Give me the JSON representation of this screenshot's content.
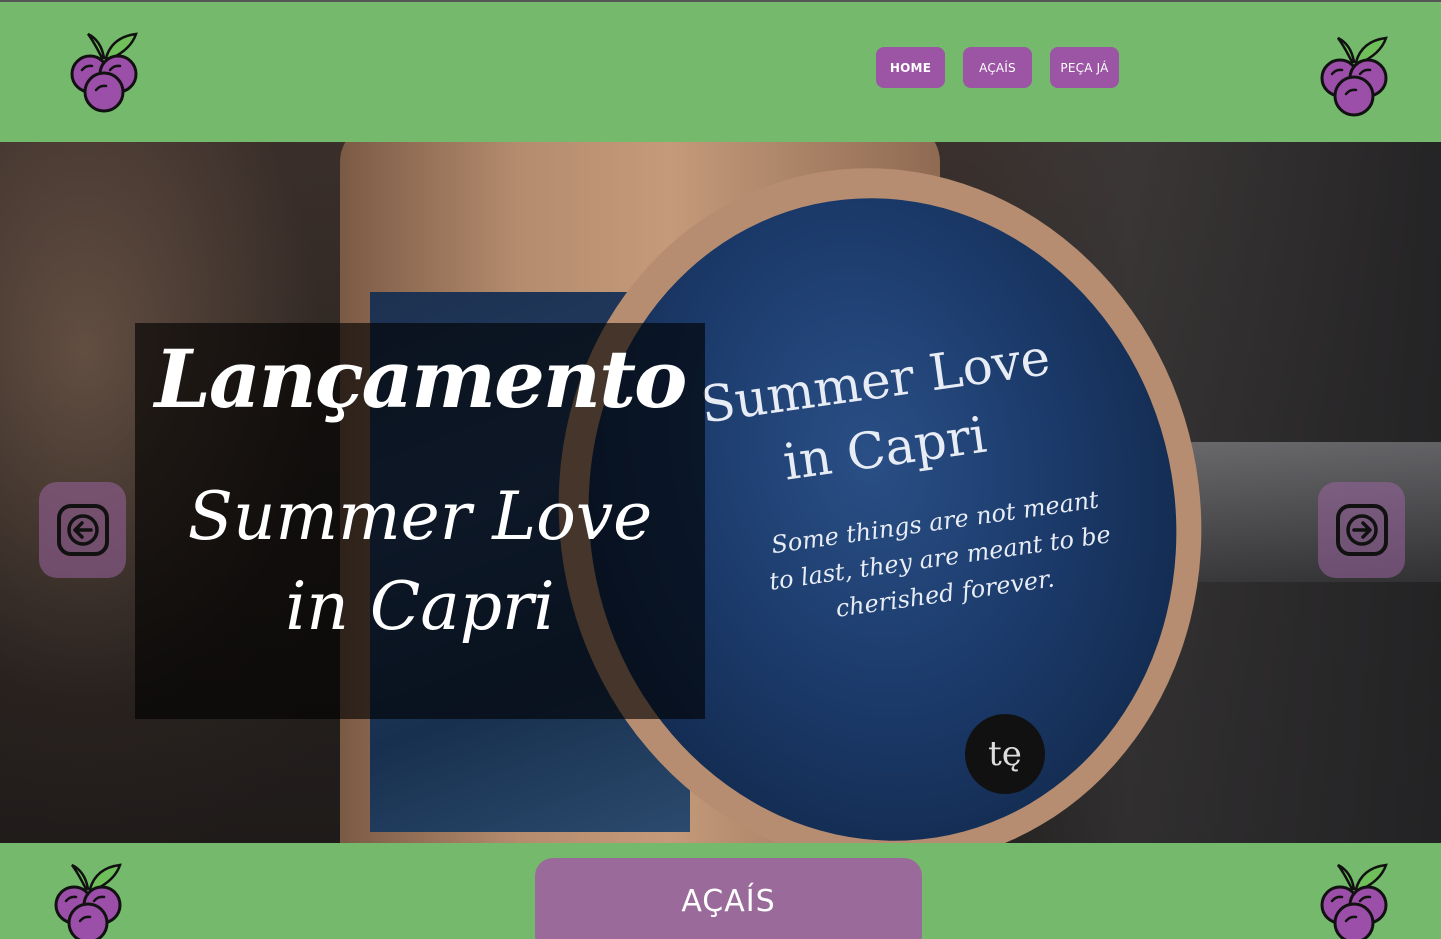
{
  "header": {
    "logo_icon": "acai-berry-icon",
    "nav": [
      {
        "label": "HOME",
        "active": true
      },
      {
        "label": "AÇAÍS",
        "active": false
      },
      {
        "label": "PEÇA JÁ",
        "active": false
      }
    ]
  },
  "hero": {
    "headline": "Lançamento",
    "subtitle_line1": "Summer Love",
    "subtitle_line2": "in Capri",
    "lid_title": "Summer Love in Capri",
    "lid_text": "Some things are not meant to last, they are meant to be cherished forever.",
    "lid_logo": "tę",
    "prev_icon": "arrow-left-icon",
    "next_icon": "arrow-right-icon"
  },
  "footer": {
    "cta_label": "AÇAÍS"
  },
  "colors": {
    "brand_green": "#74b96c",
    "brand_purple": "#9b55a4",
    "cta_purple": "#9a6a9a"
  }
}
